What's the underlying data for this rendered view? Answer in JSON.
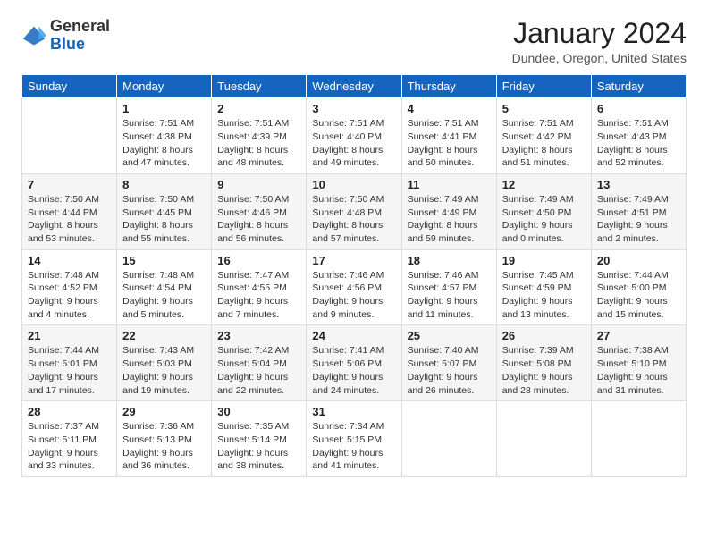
{
  "logo": {
    "general": "General",
    "blue": "Blue"
  },
  "header": {
    "month": "January 2024",
    "location": "Dundee, Oregon, United States"
  },
  "weekdays": [
    "Sunday",
    "Monday",
    "Tuesday",
    "Wednesday",
    "Thursday",
    "Friday",
    "Saturday"
  ],
  "weeks": [
    [
      {
        "day": "",
        "sunrise": "",
        "sunset": "",
        "daylight": ""
      },
      {
        "day": "1",
        "sunrise": "Sunrise: 7:51 AM",
        "sunset": "Sunset: 4:38 PM",
        "daylight": "Daylight: 8 hours and 47 minutes."
      },
      {
        "day": "2",
        "sunrise": "Sunrise: 7:51 AM",
        "sunset": "Sunset: 4:39 PM",
        "daylight": "Daylight: 8 hours and 48 minutes."
      },
      {
        "day": "3",
        "sunrise": "Sunrise: 7:51 AM",
        "sunset": "Sunset: 4:40 PM",
        "daylight": "Daylight: 8 hours and 49 minutes."
      },
      {
        "day": "4",
        "sunrise": "Sunrise: 7:51 AM",
        "sunset": "Sunset: 4:41 PM",
        "daylight": "Daylight: 8 hours and 50 minutes."
      },
      {
        "day": "5",
        "sunrise": "Sunrise: 7:51 AM",
        "sunset": "Sunset: 4:42 PM",
        "daylight": "Daylight: 8 hours and 51 minutes."
      },
      {
        "day": "6",
        "sunrise": "Sunrise: 7:51 AM",
        "sunset": "Sunset: 4:43 PM",
        "daylight": "Daylight: 8 hours and 52 minutes."
      }
    ],
    [
      {
        "day": "7",
        "sunrise": "Sunrise: 7:50 AM",
        "sunset": "Sunset: 4:44 PM",
        "daylight": "Daylight: 8 hours and 53 minutes."
      },
      {
        "day": "8",
        "sunrise": "Sunrise: 7:50 AM",
        "sunset": "Sunset: 4:45 PM",
        "daylight": "Daylight: 8 hours and 55 minutes."
      },
      {
        "day": "9",
        "sunrise": "Sunrise: 7:50 AM",
        "sunset": "Sunset: 4:46 PM",
        "daylight": "Daylight: 8 hours and 56 minutes."
      },
      {
        "day": "10",
        "sunrise": "Sunrise: 7:50 AM",
        "sunset": "Sunset: 4:48 PM",
        "daylight": "Daylight: 8 hours and 57 minutes."
      },
      {
        "day": "11",
        "sunrise": "Sunrise: 7:49 AM",
        "sunset": "Sunset: 4:49 PM",
        "daylight": "Daylight: 8 hours and 59 minutes."
      },
      {
        "day": "12",
        "sunrise": "Sunrise: 7:49 AM",
        "sunset": "Sunset: 4:50 PM",
        "daylight": "Daylight: 9 hours and 0 minutes."
      },
      {
        "day": "13",
        "sunrise": "Sunrise: 7:49 AM",
        "sunset": "Sunset: 4:51 PM",
        "daylight": "Daylight: 9 hours and 2 minutes."
      }
    ],
    [
      {
        "day": "14",
        "sunrise": "Sunrise: 7:48 AM",
        "sunset": "Sunset: 4:52 PM",
        "daylight": "Daylight: 9 hours and 4 minutes."
      },
      {
        "day": "15",
        "sunrise": "Sunrise: 7:48 AM",
        "sunset": "Sunset: 4:54 PM",
        "daylight": "Daylight: 9 hours and 5 minutes."
      },
      {
        "day": "16",
        "sunrise": "Sunrise: 7:47 AM",
        "sunset": "Sunset: 4:55 PM",
        "daylight": "Daylight: 9 hours and 7 minutes."
      },
      {
        "day": "17",
        "sunrise": "Sunrise: 7:46 AM",
        "sunset": "Sunset: 4:56 PM",
        "daylight": "Daylight: 9 hours and 9 minutes."
      },
      {
        "day": "18",
        "sunrise": "Sunrise: 7:46 AM",
        "sunset": "Sunset: 4:57 PM",
        "daylight": "Daylight: 9 hours and 11 minutes."
      },
      {
        "day": "19",
        "sunrise": "Sunrise: 7:45 AM",
        "sunset": "Sunset: 4:59 PM",
        "daylight": "Daylight: 9 hours and 13 minutes."
      },
      {
        "day": "20",
        "sunrise": "Sunrise: 7:44 AM",
        "sunset": "Sunset: 5:00 PM",
        "daylight": "Daylight: 9 hours and 15 minutes."
      }
    ],
    [
      {
        "day": "21",
        "sunrise": "Sunrise: 7:44 AM",
        "sunset": "Sunset: 5:01 PM",
        "daylight": "Daylight: 9 hours and 17 minutes."
      },
      {
        "day": "22",
        "sunrise": "Sunrise: 7:43 AM",
        "sunset": "Sunset: 5:03 PM",
        "daylight": "Daylight: 9 hours and 19 minutes."
      },
      {
        "day": "23",
        "sunrise": "Sunrise: 7:42 AM",
        "sunset": "Sunset: 5:04 PM",
        "daylight": "Daylight: 9 hours and 22 minutes."
      },
      {
        "day": "24",
        "sunrise": "Sunrise: 7:41 AM",
        "sunset": "Sunset: 5:06 PM",
        "daylight": "Daylight: 9 hours and 24 minutes."
      },
      {
        "day": "25",
        "sunrise": "Sunrise: 7:40 AM",
        "sunset": "Sunset: 5:07 PM",
        "daylight": "Daylight: 9 hours and 26 minutes."
      },
      {
        "day": "26",
        "sunrise": "Sunrise: 7:39 AM",
        "sunset": "Sunset: 5:08 PM",
        "daylight": "Daylight: 9 hours and 28 minutes."
      },
      {
        "day": "27",
        "sunrise": "Sunrise: 7:38 AM",
        "sunset": "Sunset: 5:10 PM",
        "daylight": "Daylight: 9 hours and 31 minutes."
      }
    ],
    [
      {
        "day": "28",
        "sunrise": "Sunrise: 7:37 AM",
        "sunset": "Sunset: 5:11 PM",
        "daylight": "Daylight: 9 hours and 33 minutes."
      },
      {
        "day": "29",
        "sunrise": "Sunrise: 7:36 AM",
        "sunset": "Sunset: 5:13 PM",
        "daylight": "Daylight: 9 hours and 36 minutes."
      },
      {
        "day": "30",
        "sunrise": "Sunrise: 7:35 AM",
        "sunset": "Sunset: 5:14 PM",
        "daylight": "Daylight: 9 hours and 38 minutes."
      },
      {
        "day": "31",
        "sunrise": "Sunrise: 7:34 AM",
        "sunset": "Sunset: 5:15 PM",
        "daylight": "Daylight: 9 hours and 41 minutes."
      },
      {
        "day": "",
        "sunrise": "",
        "sunset": "",
        "daylight": ""
      },
      {
        "day": "",
        "sunrise": "",
        "sunset": "",
        "daylight": ""
      },
      {
        "day": "",
        "sunrise": "",
        "sunset": "",
        "daylight": ""
      }
    ]
  ]
}
